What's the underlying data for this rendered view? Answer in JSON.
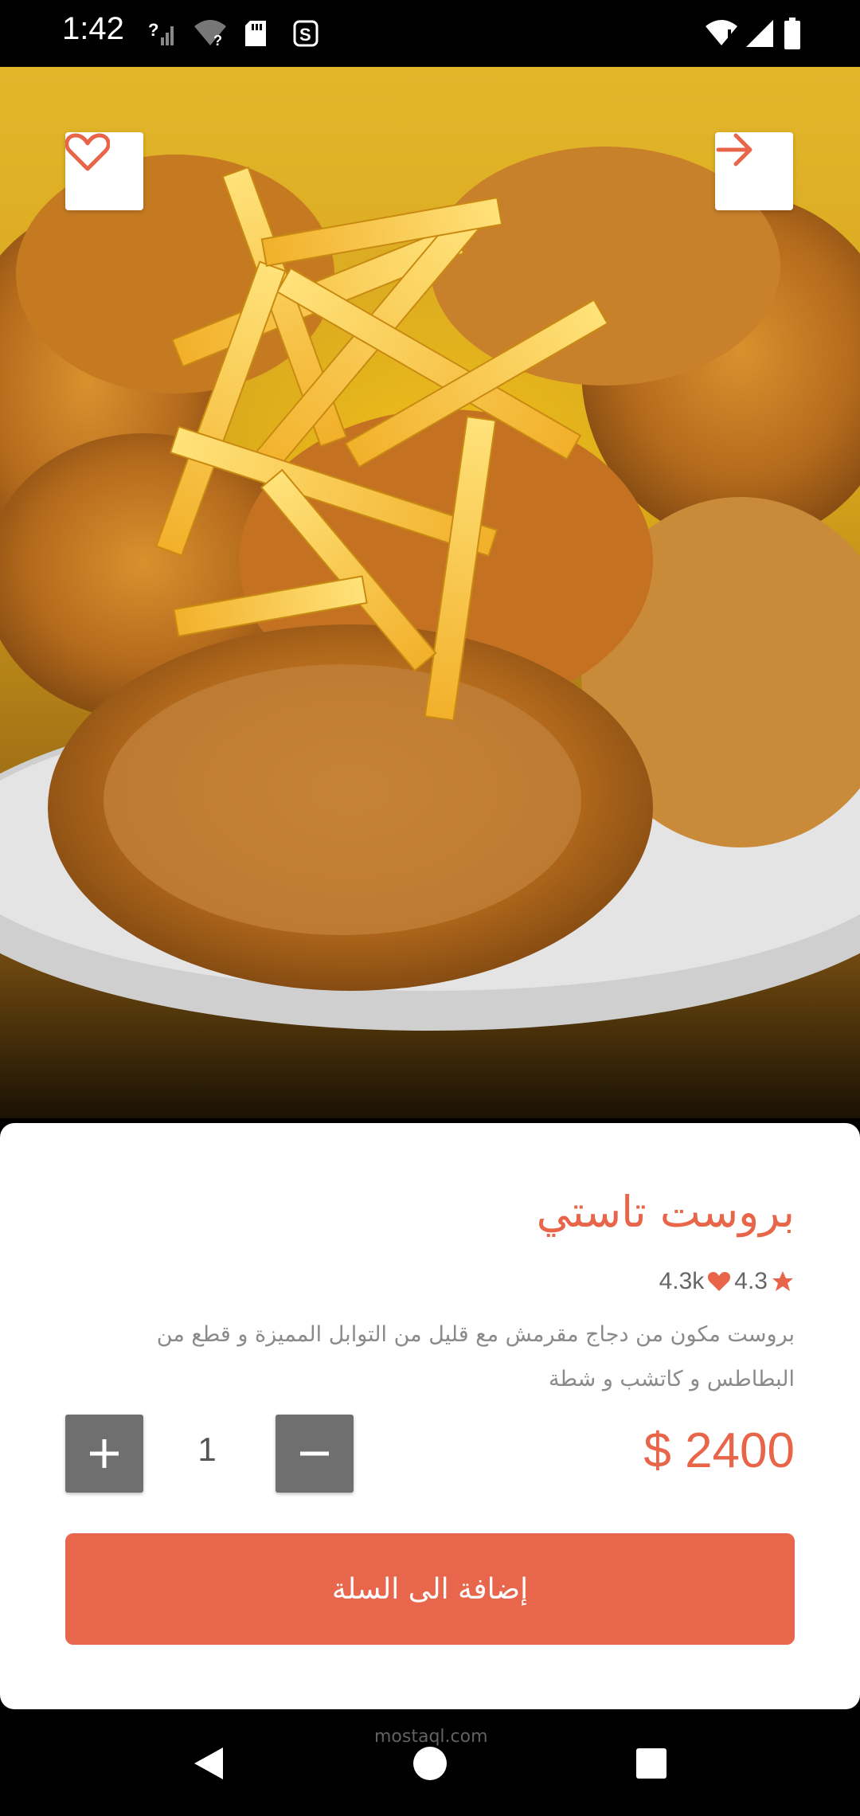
{
  "status_bar": {
    "time": "1:42",
    "icons": [
      "signal-unknown-icon",
      "wifi-unknown-icon",
      "sd-card-icon",
      "sync-icon",
      "wifi-alert-icon",
      "cell-signal-icon",
      "battery-icon"
    ]
  },
  "hero": {
    "image_description_icon": "fried-chicken-fries-photo",
    "favorite_icon": "heart-icon",
    "forward_icon": "arrow-right-icon"
  },
  "product": {
    "title": "بروست تاستي",
    "rating": "4.3",
    "likes": "4.3k",
    "description": "بروست مكون من دجاج مقرمش مع قليل من التوابل المميزة و قطع من البطاطس و كاتشب و شطة",
    "quantity": "1",
    "price": "$ 2400",
    "add_to_cart_label": "إضافة الى السلة"
  },
  "nav_bar": {
    "watermark": "mostaql.com"
  },
  "colors": {
    "accent": "#e8654a",
    "qty_button": "#6f6f6f"
  }
}
